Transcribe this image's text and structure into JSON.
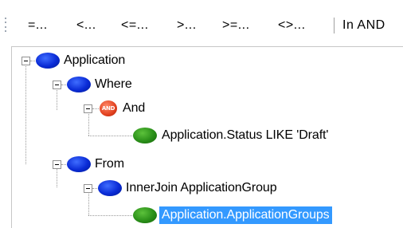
{
  "toolbar": {
    "buttons": [
      {
        "label": "=..."
      },
      {
        "label": "<..."
      },
      {
        "label": "<=..."
      },
      {
        "label": ">..."
      },
      {
        "label": ">=..."
      },
      {
        "label": "<>..."
      },
      {
        "label": "In AND"
      }
    ]
  },
  "tree": {
    "nodes": [
      {
        "label": "Application",
        "icon": "blue-circle-icon",
        "expanded": true
      },
      {
        "label": "Where",
        "icon": "blue-circle-icon",
        "expanded": true
      },
      {
        "label": "And",
        "icon": "and-operator-icon",
        "icon_text": "AND",
        "expanded": true
      },
      {
        "label": "Application.Status LIKE  'Draft'",
        "icon": "green-circle-icon"
      },
      {
        "label": "From",
        "icon": "blue-circle-icon",
        "expanded": true
      },
      {
        "label": "InnerJoin  ApplicationGroup",
        "icon": "blue-circle-icon",
        "expanded": true
      },
      {
        "label": "Application.ApplicationGroups",
        "icon": "green-circle-icon",
        "selected": true
      }
    ]
  },
  "colors": {
    "selection": "#3399ff",
    "entity_icon": "#0a2bd6",
    "leaf_icon": "#2a8f19",
    "operator_icon": "#e2411f"
  }
}
